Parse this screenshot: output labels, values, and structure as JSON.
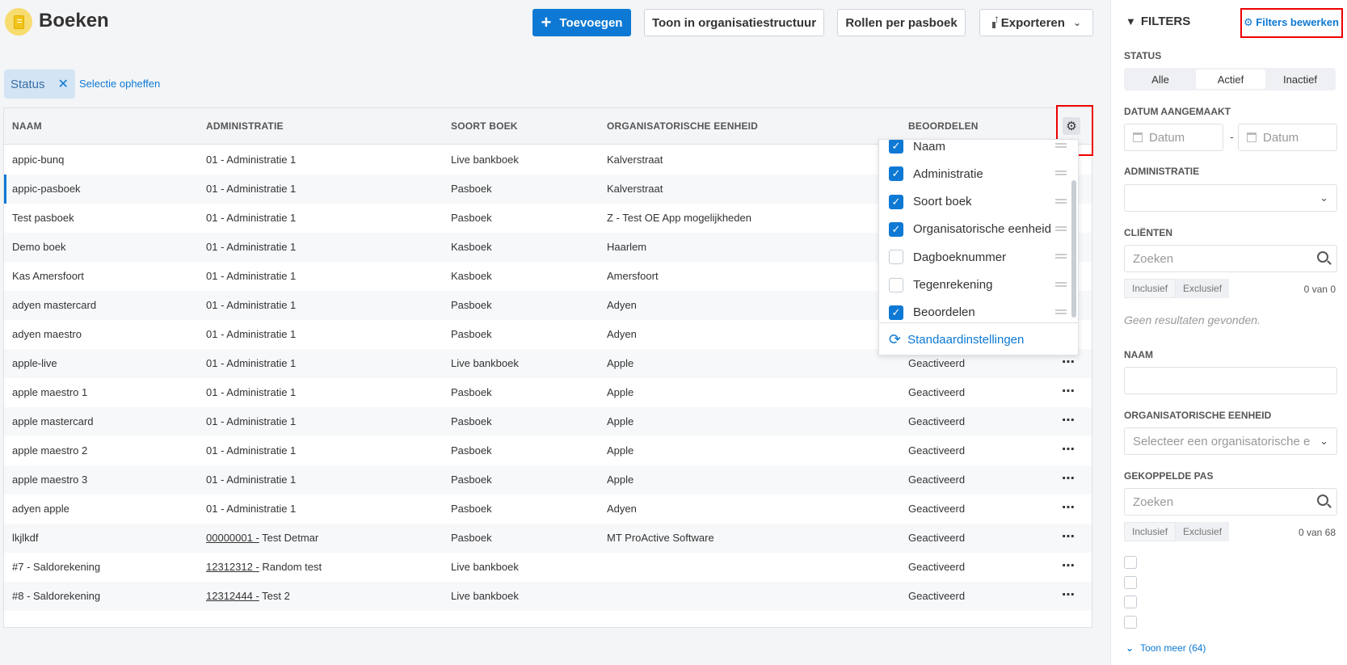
{
  "header": {
    "title": "Boeken",
    "add_label": "Toevoegen",
    "org_label": "Toon in organisatiestructuur",
    "roles_label": "Rollen per pasboek",
    "export_label": "Exporteren"
  },
  "filterbar": {
    "chip_label": "Status",
    "clear_label": "Selectie opheffen"
  },
  "table": {
    "columns": [
      "NAAM",
      "ADMINISTRATIE",
      "SOORT BOEK",
      "ORGANISATORISCHE EENHEID",
      "BEOORDELEN"
    ],
    "rows": [
      {
        "naam": "appic-bunq",
        "admin_code": "",
        "admin": "01 - Administratie 1",
        "soort": "Live bankboek",
        "eenheid": "Kalverstraat",
        "beoordelen": ""
      },
      {
        "naam": "appic-pasboek",
        "admin_code": "",
        "admin": "01 - Administratie 1",
        "soort": "Pasboek",
        "eenheid": "Kalverstraat",
        "beoordelen": ""
      },
      {
        "naam": "Test pasboek",
        "admin_code": "",
        "admin": "01 - Administratie 1",
        "soort": "Pasboek",
        "eenheid": "Z - Test OE App mogelijkheden",
        "beoordelen": ""
      },
      {
        "naam": "Demo boek",
        "admin_code": "",
        "admin": "01 - Administratie 1",
        "soort": "Kasboek",
        "eenheid": "Haarlem",
        "beoordelen": ""
      },
      {
        "naam": "Kas Amersfoort",
        "admin_code": "",
        "admin": "01 - Administratie 1",
        "soort": "Kasboek",
        "eenheid": "Amersfoort",
        "beoordelen": ""
      },
      {
        "naam": "adyen mastercard",
        "admin_code": "",
        "admin": "01 - Administratie 1",
        "soort": "Pasboek",
        "eenheid": "Adyen",
        "beoordelen": ""
      },
      {
        "naam": "adyen maestro",
        "admin_code": "",
        "admin": "01 - Administratie 1",
        "soort": "Pasboek",
        "eenheid": "Adyen",
        "beoordelen": ""
      },
      {
        "naam": "apple-live",
        "admin_code": "",
        "admin": "01 - Administratie 1",
        "soort": "Live bankboek",
        "eenheid": "Apple",
        "beoordelen": "Geactiveerd"
      },
      {
        "naam": "apple maestro 1",
        "admin_code": "",
        "admin": "01 - Administratie 1",
        "soort": "Pasboek",
        "eenheid": "Apple",
        "beoordelen": "Geactiveerd"
      },
      {
        "naam": "apple mastercard",
        "admin_code": "",
        "admin": "01 - Administratie 1",
        "soort": "Pasboek",
        "eenheid": "Apple",
        "beoordelen": "Geactiveerd"
      },
      {
        "naam": "apple maestro 2",
        "admin_code": "",
        "admin": "01 - Administratie 1",
        "soort": "Pasboek",
        "eenheid": "Apple",
        "beoordelen": "Geactiveerd"
      },
      {
        "naam": "apple maestro 3",
        "admin_code": "",
        "admin": "01 - Administratie 1",
        "soort": "Pasboek",
        "eenheid": "Apple",
        "beoordelen": "Geactiveerd"
      },
      {
        "naam": "adyen apple",
        "admin_code": "",
        "admin": "01 - Administratie 1",
        "soort": "Pasboek",
        "eenheid": "Adyen",
        "beoordelen": "Geactiveerd"
      },
      {
        "naam": "lkjlkdf",
        "admin_code": "00000001 -",
        "admin": " Test Detmar",
        "soort": "Pasboek",
        "eenheid": "MT ProActive Software",
        "beoordelen": "Geactiveerd"
      },
      {
        "naam": "#7 - Saldorekening",
        "admin_code": "12312312 -",
        "admin": " Random test",
        "soort": "Live bankboek",
        "eenheid": "",
        "beoordelen": "Geactiveerd"
      },
      {
        "naam": "#8 - Saldorekening",
        "admin_code": "12312444 -",
        "admin": " Test 2",
        "soort": "Live bankboek",
        "eenheid": "",
        "beoordelen": "Geactiveerd"
      }
    ]
  },
  "column_menu": {
    "items": [
      {
        "label": "Naam",
        "checked": true
      },
      {
        "label": "Administratie",
        "checked": true
      },
      {
        "label": "Soort boek",
        "checked": true
      },
      {
        "label": "Organisatorische eenheid",
        "checked": true
      },
      {
        "label": "Dagboeknummer",
        "checked": false
      },
      {
        "label": "Tegenrekening",
        "checked": false
      },
      {
        "label": "Beoordelen",
        "checked": true
      }
    ],
    "reset_label": "Standaardinstellingen"
  },
  "sidebar": {
    "title": "FILTERS",
    "edit_label": "Filters bewerken",
    "status": {
      "label": "STATUS",
      "options": [
        "Alle",
        "Actief",
        "Inactief"
      ],
      "selected": "Actief"
    },
    "date": {
      "label": "DATUM AANGEMAAKT",
      "from_placeholder": "Datum",
      "separator": "-",
      "to_placeholder": "Datum"
    },
    "administratie": {
      "label": "ADMINISTRATIE",
      "value": ""
    },
    "clienten": {
      "label": "CLIËNTEN",
      "placeholder": "Zoeken",
      "incl": "Inclusief",
      "excl": "Exclusief",
      "count": "0 van 0",
      "empty": "Geen resultaten gevonden."
    },
    "naam": {
      "label": "NAAM",
      "value": ""
    },
    "eenheid": {
      "label": "ORGANISATORISCHE EENHEID",
      "placeholder": "Selecteer een organisatorische eenheid"
    },
    "pas": {
      "label": "GEKOPPELDE PAS",
      "placeholder": "Zoeken",
      "incl": "Inclusief",
      "excl": "Exclusief",
      "count": "0 van 68"
    },
    "more_label": "Toon meer (64)"
  },
  "colors": {
    "accent": "#0d79d4",
    "highlight": "#e00000"
  }
}
